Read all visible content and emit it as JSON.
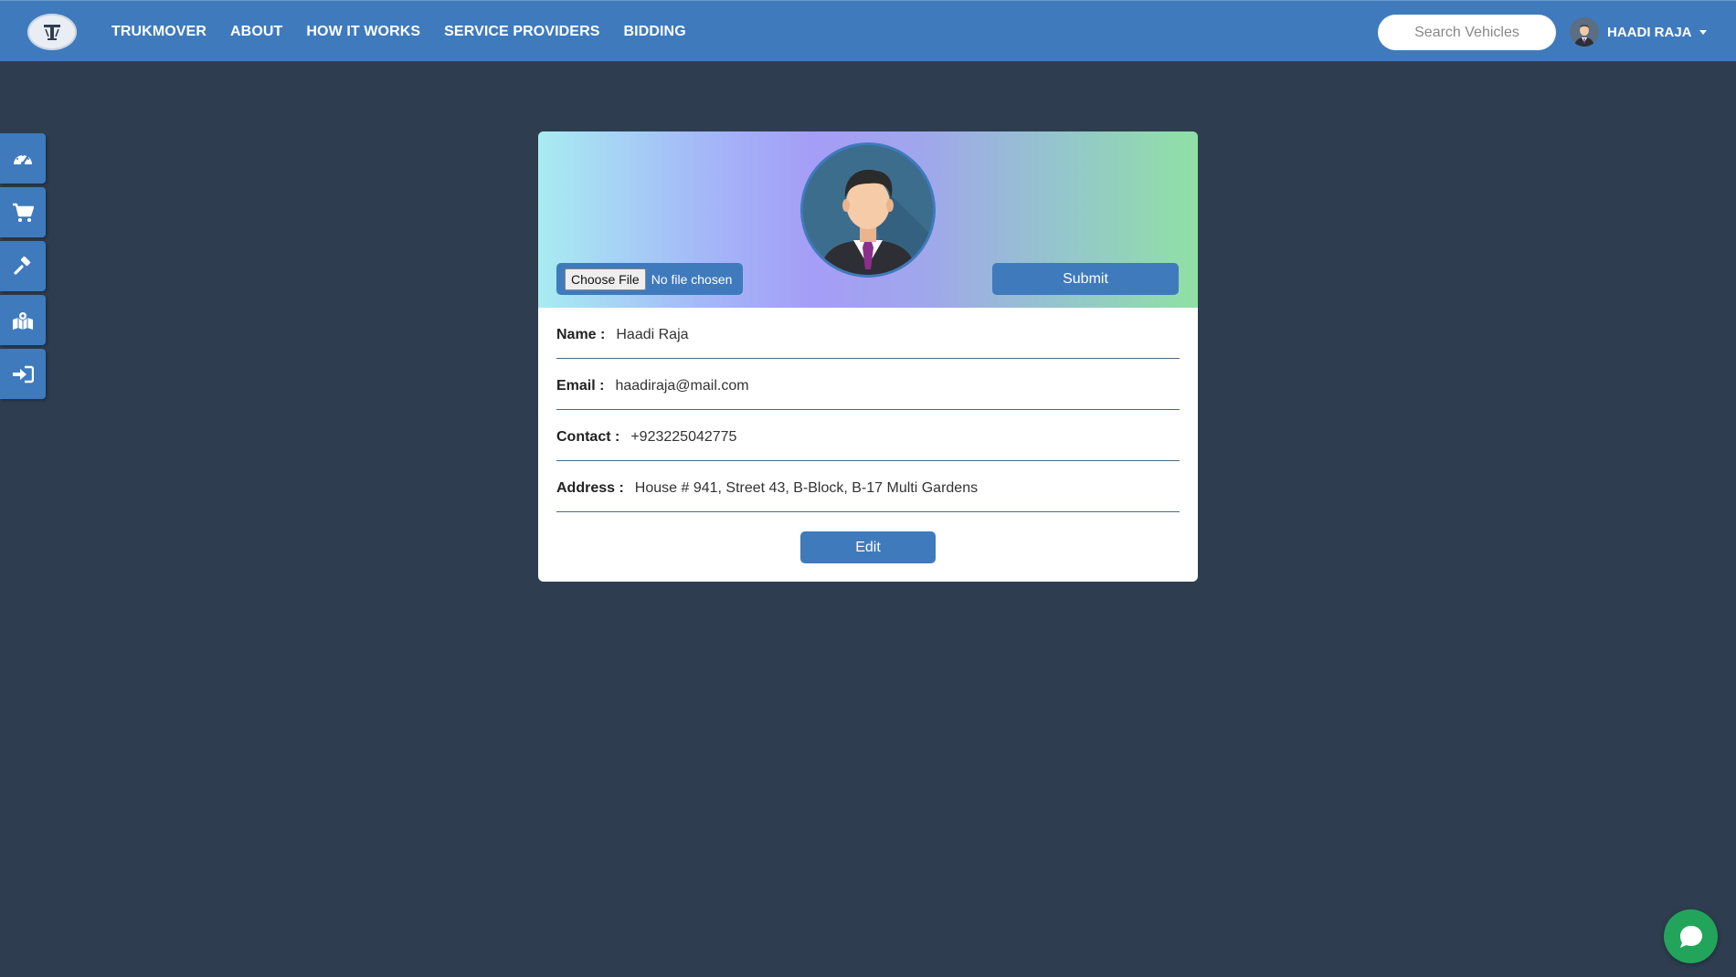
{
  "header": {
    "logo_icon": "truck-logo-icon",
    "nav": [
      {
        "label": "TRUKMOVER"
      },
      {
        "label": "ABOUT"
      },
      {
        "label": "HOW IT WORKS"
      },
      {
        "label": "SERVICE PROVIDERS"
      },
      {
        "label": "BIDDING"
      }
    ],
    "search": {
      "placeholder": "Search Vehicles",
      "value": ""
    },
    "user": {
      "name": "HAADI RAJA",
      "avatar_icon": "user-avatar-icon"
    }
  },
  "sidebar": {
    "items": [
      {
        "icon": "dashboard-icon"
      },
      {
        "icon": "cart-icon"
      },
      {
        "icon": "gavel-icon"
      },
      {
        "icon": "map-icon"
      },
      {
        "icon": "sign-in-icon"
      }
    ]
  },
  "profile": {
    "file_button": "Choose File",
    "file_status": "No file chosen",
    "submit_label": "Submit",
    "fields": [
      {
        "label": "Name :",
        "value": "Haadi Raja"
      },
      {
        "label": "Email :",
        "value": "haadiraja@mail.com"
      },
      {
        "label": "Contact :",
        "value": "+923225042775"
      },
      {
        "label": "Address :",
        "value": "House # 941, Street 43, B-Block, B-17 Multi Gardens"
      }
    ],
    "edit_label": "Edit"
  },
  "chat": {
    "icon": "chat-bubble-icon"
  },
  "colors": {
    "primary": "#3f7abd",
    "background": "#2e3e50",
    "chat": "#22a55a"
  }
}
